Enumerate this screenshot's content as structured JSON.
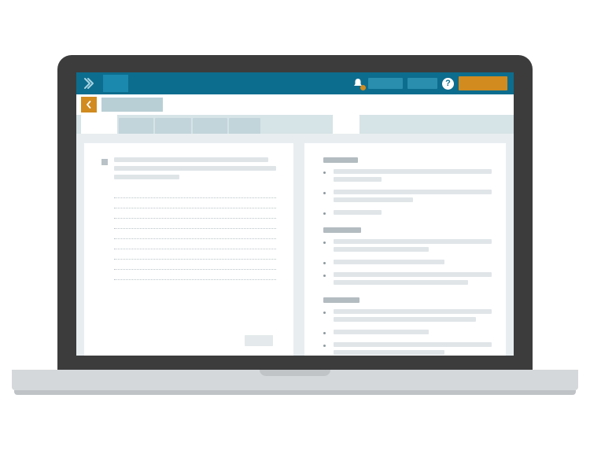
{
  "colors": {
    "brand_primary": "#0d6d8e",
    "brand_accent": "#d18b1f",
    "bezel": "#3c3c3c"
  },
  "topnav": {
    "logo_name": "chevron-logo",
    "notification_count": 1,
    "help_label": "?",
    "cta_label": "",
    "links": [
      "",
      ""
    ]
  },
  "subheader": {
    "back_label": "<",
    "title": ""
  },
  "tabs": {
    "left": [
      "",
      "",
      "",
      "",
      ""
    ],
    "active_left_index": 0,
    "right": [
      ""
    ]
  },
  "left_pane": {
    "title_lines": [
      "",
      "",
      ""
    ],
    "input_lines": 9,
    "submit_label": ""
  },
  "right_pane": {
    "sections": [
      {
        "heading": "",
        "items": [
          {
            "lines": [
              "",
              ""
            ]
          },
          {
            "lines": [
              "",
              ""
            ]
          },
          {
            "lines": [
              ""
            ]
          }
        ]
      },
      {
        "heading": "",
        "items": [
          {
            "lines": [
              "",
              ""
            ]
          },
          {
            "lines": [
              ""
            ]
          },
          {
            "lines": [
              "",
              ""
            ]
          }
        ]
      },
      {
        "heading": "",
        "items": [
          {
            "lines": [
              "",
              ""
            ]
          },
          {
            "lines": [
              ""
            ]
          },
          {
            "lines": [
              "",
              ""
            ]
          },
          {
            "lines": [
              ""
            ]
          }
        ]
      }
    ]
  }
}
